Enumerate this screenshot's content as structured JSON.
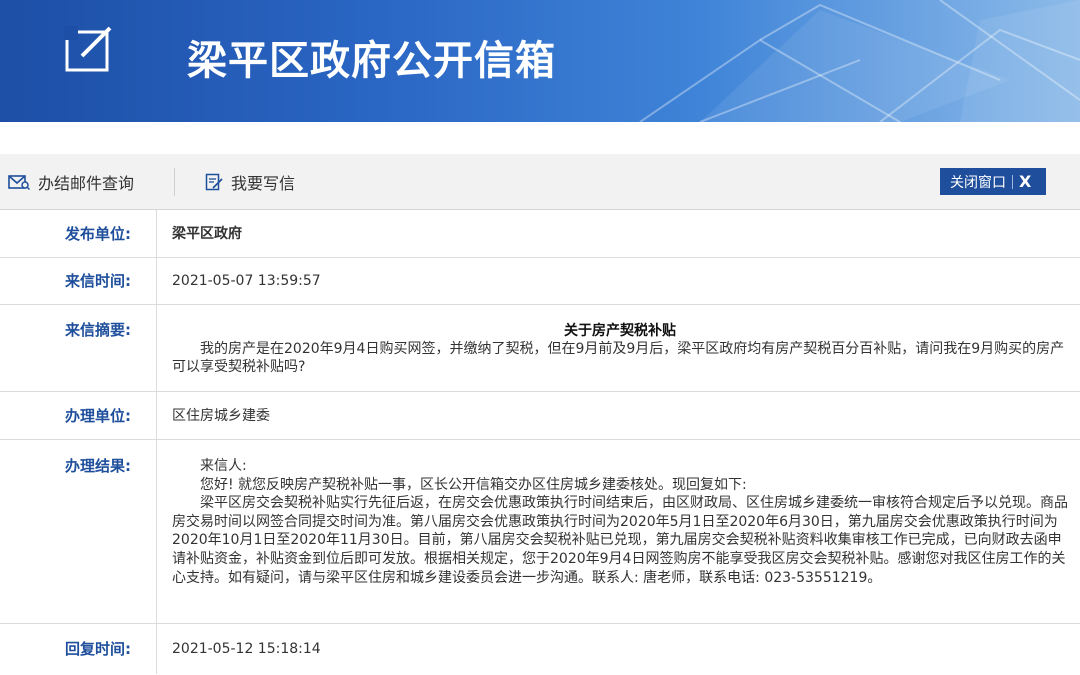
{
  "header": {
    "title": "梁平区政府公开信箱"
  },
  "toolbar": {
    "query_label": "办结邮件查询",
    "write_label": "我要写信",
    "close_label": "关闭窗口",
    "close_symbol": "X"
  },
  "letter": {
    "publisher": {
      "label": "发布单位:",
      "value": "梁平区政府"
    },
    "sent_time": {
      "label": "来信时间:",
      "value": "2021-05-07 13:59:57"
    },
    "summary": {
      "label": "来信摘要:",
      "subject": "关于房产契税补贴",
      "body": "我的房产是在2020年9月4日购买网签，并缴纳了契税，但在9月前及9月后，梁平区政府均有房产契税百分百补贴，请问我在9月购买的房产可以享受契税补贴吗?"
    },
    "handler": {
      "label": "办理单位:",
      "value": "区住房城乡建委"
    },
    "result": {
      "label": "办理结果:",
      "greeting": "来信人:",
      "line1": "您好! 就您反映房产契税补贴一事，区长公开信箱交办区住房城乡建委核处。现回复如下:",
      "line2": "梁平区房交会契税补贴实行先征后返，在房交会优惠政策执行时间结束后，由区财政局、区住房城乡建委统一审核符合规定后予以兑现。商品房交易时间以网签合同提交时间为准。第八届房交会优惠政策执行时间为2020年5月1日至2020年6月30日，第九届房交会优惠政策执行时间为2020年10月1日至2020年11月30日。目前，第八届房交会契税补贴已兑现，第九届房交会契税补贴资料收集审核工作已完成，已向财政去函申请补贴资金，补贴资金到位后即可发放。根据相关规定，您于2020年9月4日网签购房不能享受我区房交会契税补贴。感谢您对我区住房工作的关心支持。如有疑问，请与梁平区住房和城乡建设委员会进一步沟通。联系人: 唐老师，联系电话: 023-53551219。"
    },
    "reply_time": {
      "label": "回复时间:",
      "value": "2021-05-12 15:18:14"
    }
  }
}
